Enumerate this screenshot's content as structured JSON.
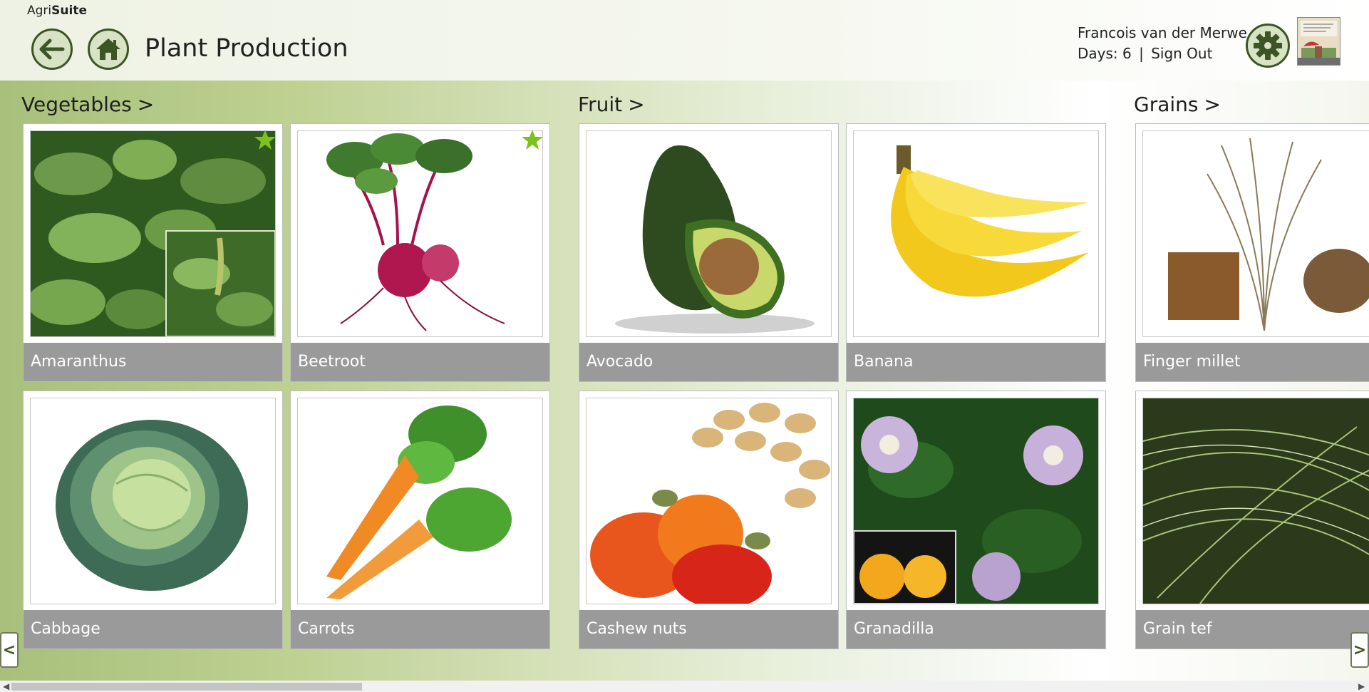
{
  "app": {
    "brand_prefix": "Agri",
    "brand_suffix": "Suite"
  },
  "header": {
    "title": "Plant Production",
    "user_name": "Francois van der Merwe",
    "days_label": "Days: 6",
    "separator": "|",
    "sign_out": "Sign Out"
  },
  "icons": {
    "back": "arrow-left-icon",
    "home": "home-icon",
    "settings": "gear-icon",
    "favorite": "star-icon"
  },
  "colors": {
    "accent": "#3d5424",
    "label_bar": "#9a9a9a",
    "favorite_star": "#7cc11c"
  },
  "groups": [
    {
      "title": "Vegetables",
      "chevron": ">",
      "items": [
        {
          "label": "Amaranthus",
          "favorite": true
        },
        {
          "label": "Beetroot",
          "favorite": true
        },
        {
          "label": "Cabbage",
          "favorite": false
        },
        {
          "label": "Carrots",
          "favorite": false
        }
      ]
    },
    {
      "title": "Fruit",
      "chevron": ">",
      "items": [
        {
          "label": "Avocado",
          "favorite": false
        },
        {
          "label": "Banana",
          "favorite": false
        },
        {
          "label": "Cashew nuts",
          "favorite": false
        },
        {
          "label": "Granadilla",
          "favorite": false
        }
      ]
    },
    {
      "title": "Grains",
      "chevron": ">",
      "items": [
        {
          "label": "Finger millet",
          "favorite": false
        },
        {
          "label": "Grain tef",
          "favorite": false
        }
      ]
    }
  ],
  "nav": {
    "left_arrow": "<",
    "right_arrow": ">"
  }
}
